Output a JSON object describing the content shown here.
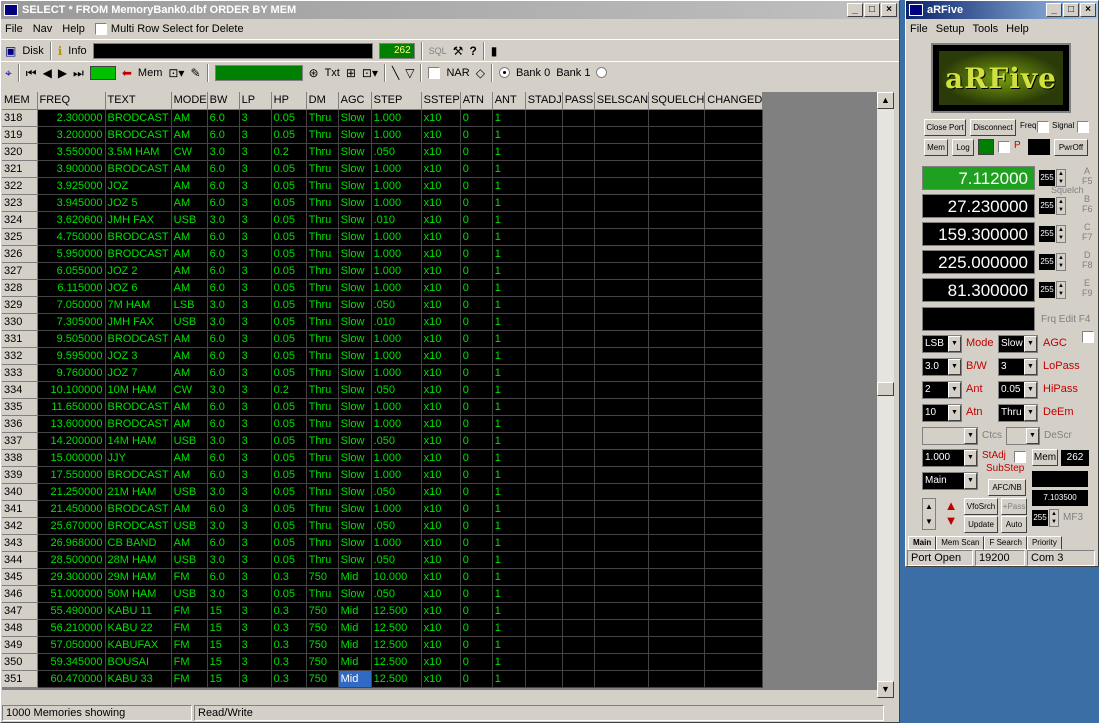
{
  "main": {
    "title": "SELECT * FROM MemoryBank0.dbf ORDER BY MEM",
    "menu": {
      "file": "File",
      "nav": "Nav",
      "help": "Help",
      "multirow": "Multi Row Select for Delete"
    },
    "toolbar1": {
      "disk": "Disk",
      "info": "Info",
      "count": "262"
    },
    "toolbar2": {
      "mem": "Mem",
      "txt": "Txt",
      "nar": "NAR",
      "bank0": "Bank 0",
      "bank1": "Bank 1"
    },
    "columns": [
      "MEM",
      "FREQ",
      "TEXT",
      "MODE",
      "BW",
      "LP",
      "HP",
      "DM",
      "AGC",
      "STEP",
      "SSTEP",
      "ATN",
      "ANT",
      "STADJ",
      "PASS",
      "SELSCAN",
      "SQUELCH",
      "CHANGED"
    ],
    "rows": [
      [
        "318",
        "2.300000",
        "BRODCAST",
        "AM",
        "6.0",
        "3",
        "0.05",
        "Thru",
        "Slow",
        "1.000",
        "x10",
        "0",
        "1"
      ],
      [
        "319",
        "3.200000",
        "BRODCAST",
        "AM",
        "6.0",
        "3",
        "0.05",
        "Thru",
        "Slow",
        "1.000",
        "x10",
        "0",
        "1"
      ],
      [
        "320",
        "3.550000",
        "3.5M HAM",
        "CW",
        "3.0",
        "3",
        "0.2",
        "Thru",
        "Slow",
        ".050",
        "x10",
        "0",
        "1"
      ],
      [
        "321",
        "3.900000",
        "BRODCAST",
        "AM",
        "6.0",
        "3",
        "0.05",
        "Thru",
        "Slow",
        "1.000",
        "x10",
        "0",
        "1"
      ],
      [
        "322",
        "3.925000",
        "JOZ",
        "AM",
        "6.0",
        "3",
        "0.05",
        "Thru",
        "Slow",
        "1.000",
        "x10",
        "0",
        "1"
      ],
      [
        "323",
        "3.945000",
        "JOZ 5",
        "AM",
        "6.0",
        "3",
        "0.05",
        "Thru",
        "Slow",
        "1.000",
        "x10",
        "0",
        "1"
      ],
      [
        "324",
        "3.620600",
        "JMH FAX",
        "USB",
        "3.0",
        "3",
        "0.05",
        "Thru",
        "Slow",
        ".010",
        "x10",
        "0",
        "1"
      ],
      [
        "325",
        "4.750000",
        "BRODCAST",
        "AM",
        "6.0",
        "3",
        "0.05",
        "Thru",
        "Slow",
        "1.000",
        "x10",
        "0",
        "1"
      ],
      [
        "326",
        "5.950000",
        "BRODCAST",
        "AM",
        "6.0",
        "3",
        "0.05",
        "Thru",
        "Slow",
        "1.000",
        "x10",
        "0",
        "1"
      ],
      [
        "327",
        "6.055000",
        "JOZ 2",
        "AM",
        "6.0",
        "3",
        "0.05",
        "Thru",
        "Slow",
        "1.000",
        "x10",
        "0",
        "1"
      ],
      [
        "328",
        "6.115000",
        "JOZ 6",
        "AM",
        "6.0",
        "3",
        "0.05",
        "Thru",
        "Slow",
        "1.000",
        "x10",
        "0",
        "1"
      ],
      [
        "329",
        "7.050000",
        "7M HAM",
        "LSB",
        "3.0",
        "3",
        "0.05",
        "Thru",
        "Slow",
        ".050",
        "x10",
        "0",
        "1"
      ],
      [
        "330",
        "7.305000",
        "JMH FAX",
        "USB",
        "3.0",
        "3",
        "0.05",
        "Thru",
        "Slow",
        ".010",
        "x10",
        "0",
        "1"
      ],
      [
        "331",
        "9.505000",
        "BRODCAST",
        "AM",
        "6.0",
        "3",
        "0.05",
        "Thru",
        "Slow",
        "1.000",
        "x10",
        "0",
        "1"
      ],
      [
        "332",
        "9.595000",
        "JOZ 3",
        "AM",
        "6.0",
        "3",
        "0.05",
        "Thru",
        "Slow",
        "1.000",
        "x10",
        "0",
        "1"
      ],
      [
        "333",
        "9.760000",
        "JOZ 7",
        "AM",
        "6.0",
        "3",
        "0.05",
        "Thru",
        "Slow",
        "1.000",
        "x10",
        "0",
        "1"
      ],
      [
        "334",
        "10.100000",
        "10M HAM",
        "CW",
        "3.0",
        "3",
        "0.2",
        "Thru",
        "Slow",
        ".050",
        "x10",
        "0",
        "1"
      ],
      [
        "335",
        "11.650000",
        "BRODCAST",
        "AM",
        "6.0",
        "3",
        "0.05",
        "Thru",
        "Slow",
        "1.000",
        "x10",
        "0",
        "1"
      ],
      [
        "336",
        "13.600000",
        "BRODCAST",
        "AM",
        "6.0",
        "3",
        "0.05",
        "Thru",
        "Slow",
        "1.000",
        "x10",
        "0",
        "1"
      ],
      [
        "337",
        "14.200000",
        "14M HAM",
        "USB",
        "3.0",
        "3",
        "0.05",
        "Thru",
        "Slow",
        ".050",
        "x10",
        "0",
        "1"
      ],
      [
        "338",
        "15.000000",
        "JJY",
        "AM",
        "6.0",
        "3",
        "0.05",
        "Thru",
        "Slow",
        "1.000",
        "x10",
        "0",
        "1"
      ],
      [
        "339",
        "17.550000",
        "BRODCAST",
        "AM",
        "6.0",
        "3",
        "0.05",
        "Thru",
        "Slow",
        "1.000",
        "x10",
        "0",
        "1"
      ],
      [
        "340",
        "21.250000",
        "21M HAM",
        "USB",
        "3.0",
        "3",
        "0.05",
        "Thru",
        "Slow",
        ".050",
        "x10",
        "0",
        "1"
      ],
      [
        "341",
        "21.450000",
        "BRODCAST",
        "AM",
        "6.0",
        "3",
        "0.05",
        "Thru",
        "Slow",
        "1.000",
        "x10",
        "0",
        "1"
      ],
      [
        "342",
        "25.670000",
        "BRODCAST",
        "USB",
        "3.0",
        "3",
        "0.05",
        "Thru",
        "Slow",
        ".050",
        "x10",
        "0",
        "1"
      ],
      [
        "343",
        "26.968000",
        "CB BAND",
        "AM",
        "6.0",
        "3",
        "0.05",
        "Thru",
        "Slow",
        "1.000",
        "x10",
        "0",
        "1"
      ],
      [
        "344",
        "28.500000",
        "28M HAM",
        "USB",
        "3.0",
        "3",
        "0.05",
        "Thru",
        "Slow",
        ".050",
        "x10",
        "0",
        "1"
      ],
      [
        "345",
        "29.300000",
        "29M HAM",
        "FM",
        "6.0",
        "3",
        "0.3",
        "750",
        "Mid",
        "10.000",
        "x10",
        "0",
        "1"
      ],
      [
        "346",
        "51.000000",
        "50M HAM",
        "USB",
        "3.0",
        "3",
        "0.05",
        "Thru",
        "Slow",
        ".050",
        "x10",
        "0",
        "1"
      ],
      [
        "347",
        "55.490000",
        "KABU 11",
        "FM",
        "15",
        "3",
        "0.3",
        "750",
        "Mid",
        "12.500",
        "x10",
        "0",
        "1"
      ],
      [
        "348",
        "56.210000",
        "KABU 22",
        "FM",
        "15",
        "3",
        "0.3",
        "750",
        "Mid",
        "12.500",
        "x10",
        "0",
        "1"
      ],
      [
        "349",
        "57.050000",
        "KABUFAX",
        "FM",
        "15",
        "3",
        "0.3",
        "750",
        "Mid",
        "12.500",
        "x10",
        "0",
        "1"
      ],
      [
        "350",
        "59.345000",
        "BOUSAI",
        "FM",
        "15",
        "3",
        "0.3",
        "750",
        "Mid",
        "12.500",
        "x10",
        "0",
        "1"
      ],
      [
        "351",
        "60.470000",
        "KABU 33",
        "FM",
        "15",
        "3",
        "0.3",
        "750",
        "Mid",
        "12.500",
        "x10",
        "0",
        "1"
      ]
    ],
    "status": {
      "memories": "1000 Memories showing",
      "mode": "Read/Write"
    }
  },
  "rf": {
    "title": "aRFive",
    "menu": {
      "file": "File",
      "setup": "Setup",
      "tools": "Tools",
      "help": "Help"
    },
    "logo": "aRFive",
    "buttons": {
      "close_port": "Close Port",
      "disconnect": "Disconnect",
      "freq": "Freq",
      "signal": "Signal",
      "mem": "Mem",
      "log": "Log",
      "p": "P",
      "pwroff": "PwrOff"
    },
    "freqs": [
      {
        "value": "7.112000",
        "spin": "255",
        "key": "A",
        "fkey": "F5"
      },
      {
        "value": "27.230000",
        "spin": "255",
        "key": "B",
        "fkey": "F6"
      },
      {
        "value": "159.300000",
        "spin": "255",
        "key": "C",
        "fkey": "F7"
      },
      {
        "value": "225.000000",
        "spin": "255",
        "key": "D",
        "fkey": "F8"
      },
      {
        "value": "81.300000",
        "spin": "255",
        "key": "E",
        "fkey": "F9"
      }
    ],
    "squelch": "Squelch",
    "frq_edit": "Frq Edit  F4",
    "mode_val": "LSB",
    "mode_lbl": "Mode",
    "agc_val": "Slow",
    "agc_lbl": "AGC",
    "bw_val": "3.0",
    "bw_lbl": "B/W",
    "lopass_val": "3",
    "lopass_lbl": "LoPass",
    "ant_val": "2",
    "ant_lbl": "Ant",
    "hipass_val": "0.05",
    "hipass_lbl": "HiPass",
    "atn_val": "10",
    "atn_lbl": "Atn",
    "deem_val": "Thru",
    "deem_lbl": "DeEm",
    "ctcs_lbl": "Ctcs",
    "descr_lbl": "DeScr",
    "stadj_val": "1.000",
    "stadj_lbl": "StAdj",
    "mem_lbl": "Mem",
    "mem_val": "262",
    "substep_lbl": "SubStep",
    "main_val": "Main",
    "afcnb": "AFC/NB",
    "mini_freq": "7.103500",
    "vfosrch": "VfoSrch",
    "apass": "+Pass",
    "update": "Update",
    "auto": "Auto",
    "mf_spin": "255",
    "mf_lbl": "MF3",
    "tabs": [
      "Main",
      "Mem Scan",
      "F Search",
      "Priority"
    ],
    "status": {
      "port": "Port Open",
      "baud": "19200",
      "com": "Com 3"
    }
  }
}
